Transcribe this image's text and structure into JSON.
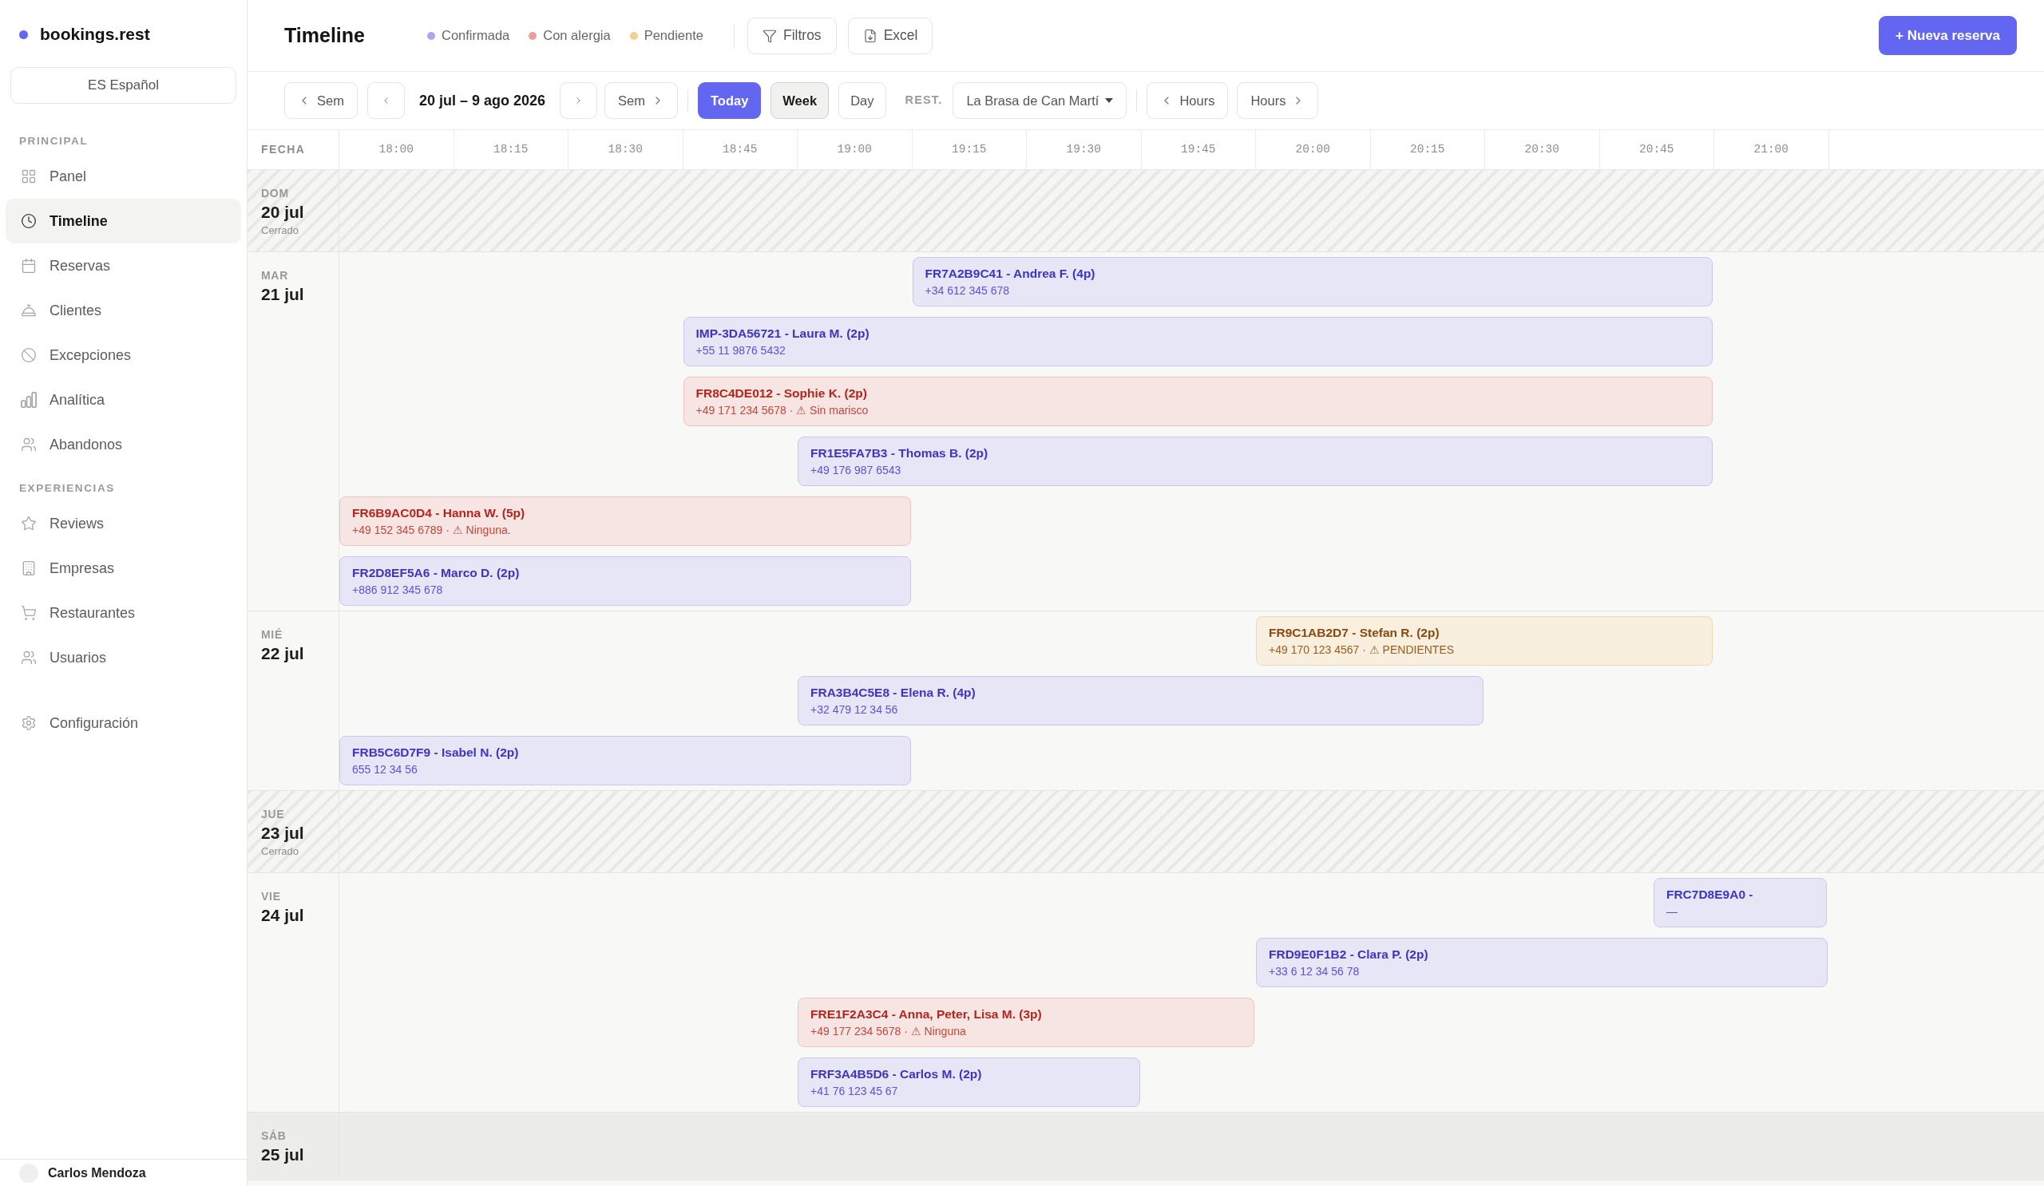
{
  "sidebar": {
    "brand": "bookings.rest",
    "language_button": "ES Español",
    "sections": [
      {
        "heading": "PRINCIPAL",
        "items": [
          {
            "label": "Panel",
            "selected": false
          },
          {
            "label": "Timeline",
            "selected": true
          },
          {
            "label": "Reservas",
            "selected": false
          },
          {
            "label": "Clientes",
            "selected": false
          },
          {
            "label": "Excepciones",
            "selected": false
          },
          {
            "label": "Analítica",
            "selected": false
          },
          {
            "label": "Abandonos",
            "selected": false
          }
        ]
      },
      {
        "heading": "EXPERIENCIAS",
        "items": [
          {
            "label": "Reviews",
            "selected": false
          },
          {
            "label": "Empresas",
            "selected": false
          },
          {
            "label": "Restaurantes",
            "selected": false
          },
          {
            "label": "Usuarios",
            "selected": false
          }
        ]
      }
    ],
    "settings_item": {
      "label": "Configuración",
      "selected": false
    },
    "user": {
      "name": "Carlos Mendoza"
    }
  },
  "header": {
    "title": "Timeline",
    "legend": [
      {
        "label": "Confirmada",
        "color": "#a9a7f3"
      },
      {
        "label": "Con alergia",
        "color": "#ee9e98"
      },
      {
        "label": "Pendiente",
        "color": "#f3cf91"
      }
    ],
    "filter_button": "Filtros",
    "export_button": "Excel",
    "new_button": "+ Nueva reserva"
  },
  "toolbar": {
    "week_back_button": "Sem",
    "date_range": "20 jul – 9 ago 2026",
    "week_forward_button": "Sem",
    "today_button": "Today",
    "views": [
      {
        "label": "Week",
        "selected": true
      },
      {
        "label": "Day",
        "selected": false
      }
    ],
    "restaurant_label": "REST.",
    "restaurant_select": "La Brasa de Can Martí",
    "hours_back_button": "Hours",
    "hours_forward_button": "Hours"
  },
  "timeline": {
    "date_column": "FECHA",
    "times": [
      "18:00",
      "18:15",
      "18:30",
      "18:45",
      "19:00",
      "19:15",
      "19:30",
      "19:45",
      "20:00",
      "20:15",
      "20:30",
      "20:45",
      "21:00"
    ],
    "days": [
      {
        "weekday": "DOM",
        "date": "20 jul",
        "note": "Cerrado",
        "closed": true,
        "highlighted": false
      },
      {
        "weekday": "MAR",
        "date": "21 jul",
        "closed": false,
        "highlighted": false,
        "bookings": [
          {
            "title": "FR7A2B9C41 - Andrea F. (4p)",
            "detail": "+34 612 345 678",
            "kind": "confirmed"
          },
          {
            "title": "IMP-3DA56721 - Laura M. (2p)",
            "detail": "+55 11 9876 5432",
            "kind": "confirmed"
          },
          {
            "title": "FR8C4DE012 - Sophie K. (2p)",
            "detail": "+49 171 234 5678 · ⚠ Sin marisco",
            "kind": "allergy"
          },
          {
            "title": "FR1E5FA7B3 - Thomas B. (2p)",
            "detail": "+49 176 987 6543",
            "kind": "confirmed"
          },
          {
            "title": "FR6B9AC0D4 - Hanna W. (5p)",
            "detail": "+49 152 345 6789 · ⚠ Ninguna.",
            "kind": "allergy"
          },
          {
            "title": "FR2D8EF5A6 - Marco D. (2p)",
            "detail": "+886 912 345 678",
            "kind": "confirmed"
          }
        ]
      },
      {
        "weekday": "MIÉ",
        "date": "22 jul",
        "closed": false,
        "highlighted": false,
        "bookings": [
          {
            "title": "FR9C1AB2D7 - Stefan R. (2p)",
            "detail": "+49 170 123 4567 · ⚠ PENDIENTES",
            "kind": "pending"
          },
          {
            "title": "FRA3B4C5E8 - Elena R. (4p)",
            "detail": "+32 479 12 34 56",
            "kind": "confirmed"
          },
          {
            "title": "FRB5C6D7F9 - Isabel N. (2p)",
            "detail": "655 12 34 56",
            "kind": "confirmed"
          }
        ]
      },
      {
        "weekday": "JUE",
        "date": "23 jul",
        "note": "Cerrado",
        "closed": true,
        "highlighted": false
      },
      {
        "weekday": "VIE",
        "date": "24 jul",
        "closed": false,
        "highlighted": false,
        "bookings": [
          {
            "title": "FRC7D8E9A0 -",
            "detail": "—",
            "kind": "confirmed"
          },
          {
            "title": "FRD9E0F1B2 - Clara P. (2p)",
            "detail": "+33 6 12 34 56 78",
            "kind": "confirmed"
          },
          {
            "title": "FRE1F2A3C4 - Anna, Peter, Lisa M. (3p)",
            "detail": "+49 177 234 5678 · ⚠ Ninguna",
            "kind": "allergy"
          },
          {
            "title": "FRF3A4B5D6 - Carlos M. (2p)",
            "detail": "+41 76 123 45 67",
            "kind": "confirmed"
          }
        ]
      },
      {
        "weekday": "SÁB",
        "date": "25 jul",
        "closed": false,
        "highlighted": true
      }
    ]
  }
}
